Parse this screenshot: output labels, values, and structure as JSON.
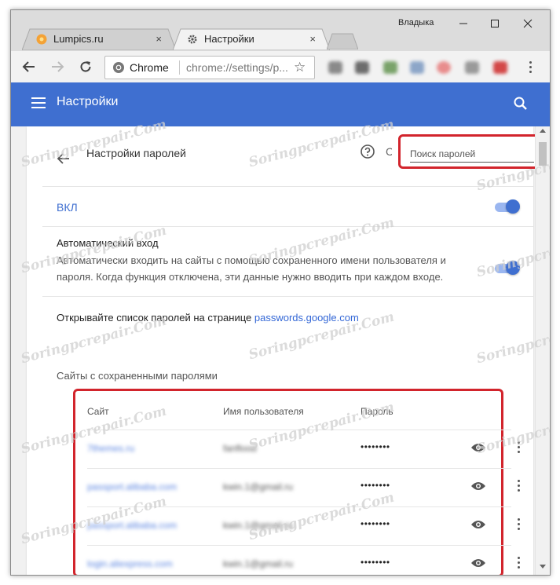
{
  "window": {
    "user_name": "Владыка",
    "controls": {
      "minimize_icon": "minimize-icon",
      "maximize_icon": "maximize-icon",
      "close_icon": "close-icon"
    }
  },
  "tabs": [
    {
      "title": "Lumpics.ru",
      "icon": "orange-flower-favicon",
      "active": false,
      "close": "×"
    },
    {
      "title": "Настройки",
      "icon": "gear-icon",
      "active": true,
      "close": "×"
    }
  ],
  "toolbar": {
    "omnibox_scheme": "Chrome",
    "omnibox_url": "chrome://settings/p...",
    "star_icon": "☆"
  },
  "appbar": {
    "title": "Настройки"
  },
  "passwords": {
    "subtitle": "Настройки паролей",
    "search_placeholder": "Поиск паролей",
    "toggle_label": "ВКЛ",
    "autologin_title": "Автоматический вход",
    "autologin_desc": "Автоматически входить на сайты с помощью сохраненного имени пользователя и пароля. Когда функция отключена, эти данные нужно вводить при каждом входе.",
    "open_list_text": "Открывайте список паролей на странице ",
    "open_list_link": "passwords.google.com",
    "saved_section_title": "Сайты с сохраненными паролями",
    "columns": {
      "site": "Сайт",
      "username": "Имя пользователя",
      "password": "Пароль"
    },
    "rows": [
      {
        "site": "7themes.ru",
        "username": "fanflood",
        "password": "••••••••"
      },
      {
        "site": "passport.alibaba.com",
        "username": "kwin.1@gmail.ru",
        "password": "••••••••"
      },
      {
        "site": "passport.alibaba.com",
        "username": "kwin.1@gmail.ru",
        "password": "••••••••"
      },
      {
        "site": "login.aliexpress.com",
        "username": "kwin.1@gmail.ru",
        "password": "••••••••"
      }
    ]
  },
  "watermark": "Soringpcrepair.Com",
  "colors": {
    "accent": "#3f6fd0",
    "highlight": "#d2242c",
    "link": "#3367d6"
  }
}
